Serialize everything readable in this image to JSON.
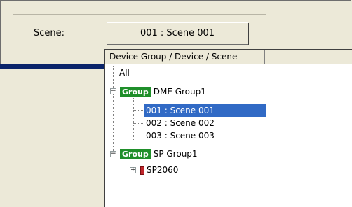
{
  "scene": {
    "label": "Scene:",
    "button_value": "001 : Scene 001"
  },
  "dropdown": {
    "header": "Device Group / Device / Scene",
    "items": [
      {
        "label": "All"
      },
      {
        "group_badge": "Group",
        "label": "DME Group1"
      },
      {
        "label": "001 : Scene 001",
        "selected": true
      },
      {
        "label": "002 : Scene 002"
      },
      {
        "label": "003 : Scene 003"
      },
      {
        "group_badge": "Group",
        "label": "SP Group1"
      },
      {
        "label": "SP2060"
      }
    ]
  },
  "colors": {
    "badge": "#1f8f2a",
    "selection": "#316ac5",
    "title_bar": "#0a246a",
    "device_icon": "#c0262b"
  }
}
